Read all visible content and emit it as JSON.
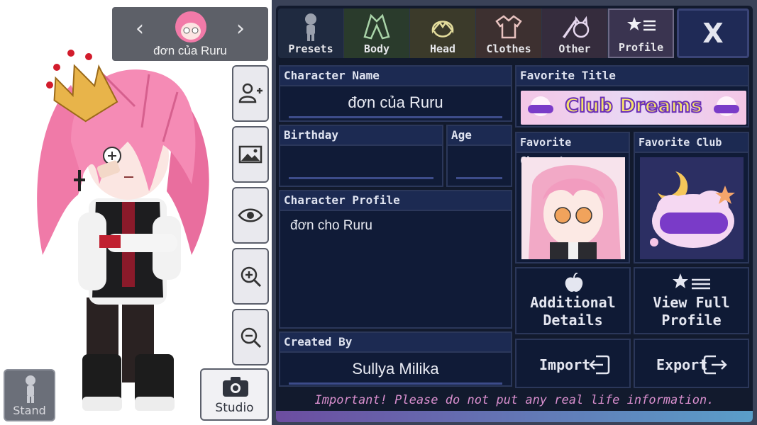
{
  "character_nav": {
    "prev_icon": "chevron-left-icon",
    "next_icon": "chevron-right-icon",
    "name": "đơn của Ruru"
  },
  "side_tools": [
    {
      "name": "add-character",
      "icon": "add-person-icon"
    },
    {
      "name": "background",
      "icon": "image-icon"
    },
    {
      "name": "visibility",
      "icon": "eye-icon"
    },
    {
      "name": "zoom-in",
      "icon": "zoom-in-icon"
    },
    {
      "name": "zoom-out",
      "icon": "zoom-out-icon"
    }
  ],
  "stand_button": {
    "label": "Stand",
    "icon": "stand-figure-icon"
  },
  "studio_button": {
    "label": "Studio",
    "icon": "camera-icon"
  },
  "tabs": [
    {
      "label": "Presets",
      "icon": "figure-icon",
      "color": "#1f2a40"
    },
    {
      "label": "Body",
      "icon": "jacket-icon",
      "color": "#2a3b2c"
    },
    {
      "label": "Head",
      "icon": "hair-icon",
      "color": "#3b3a2a"
    },
    {
      "label": "Clothes",
      "icon": "shirt-icon",
      "color": "#3d3030"
    },
    {
      "label": "Other",
      "icon": "sword-cat-icon",
      "color": "#352c3d"
    },
    {
      "label": "Profile",
      "icon": "star-list-icon",
      "color": "#3a3450"
    }
  ],
  "close_button": {
    "label": "X"
  },
  "profile": {
    "character_name_label": "Character Name",
    "character_name": "đơn của Ruru",
    "birthday_label": "Birthday",
    "birthday": "",
    "age_label": "Age",
    "age": "",
    "character_profile_label": "Character Profile",
    "character_profile": "đơn cho Ruru",
    "created_by_label": "Created By",
    "created_by": "Sullya Milika",
    "favorite_title_label": "Favorite Title",
    "favorite_title": "Club Dreams",
    "favorite_character_label": "Favorite Character",
    "favorite_club_label": "Favorite Club"
  },
  "actions": {
    "additional_line1": "Additional",
    "additional_line2": "Details",
    "view_line1": "View Full",
    "view_line2": "Profile",
    "import": "Import",
    "export": "Export"
  },
  "warning": "Important! Please do not put any real life information."
}
